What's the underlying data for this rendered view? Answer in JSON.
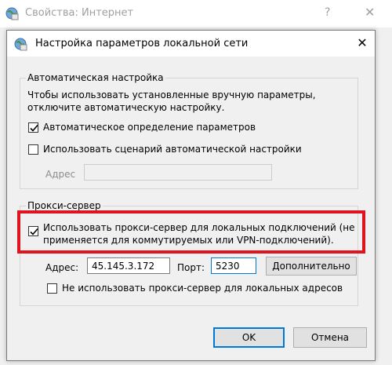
{
  "bg_window": {
    "title": "Свойства: Интернет",
    "help_glyph": "?",
    "close_glyph": "✕"
  },
  "dialog": {
    "title": "Настройка параметров локальной сети",
    "close_glyph": "✕",
    "auto_group": {
      "legend": "Автоматическая настройка",
      "description_line1": "Чтобы использовать установленные вручную параметры,",
      "description_line2": "отключите автоматическую настройку.",
      "auto_detect": {
        "label": "Автоматическое определение параметров",
        "checked": true
      },
      "use_script": {
        "label": "Использовать сценарий автоматической настройки",
        "checked": false
      },
      "address_label": "Адрес",
      "address_value": ""
    },
    "proxy_group": {
      "legend": "Прокси-сервер",
      "use_proxy": {
        "label_line1": "Использовать прокси-сервер для локальных подключений (не",
        "label_line2": "применяется для коммутируемых или VPN-подключений).",
        "checked": true
      },
      "address_label": "Адрес:",
      "address_value": "45.145.3.172",
      "port_label": "Порт:",
      "port_value": "5230",
      "advanced_button": "Дополнительно",
      "bypass_local": {
        "label": "Не использовать прокси-сервер для локальных адресов",
        "checked": false
      }
    },
    "ok_button": "OK",
    "cancel_button": "Отмена"
  },
  "colors": {
    "highlight": "#e0141e",
    "focus_border": "#0078d7"
  }
}
